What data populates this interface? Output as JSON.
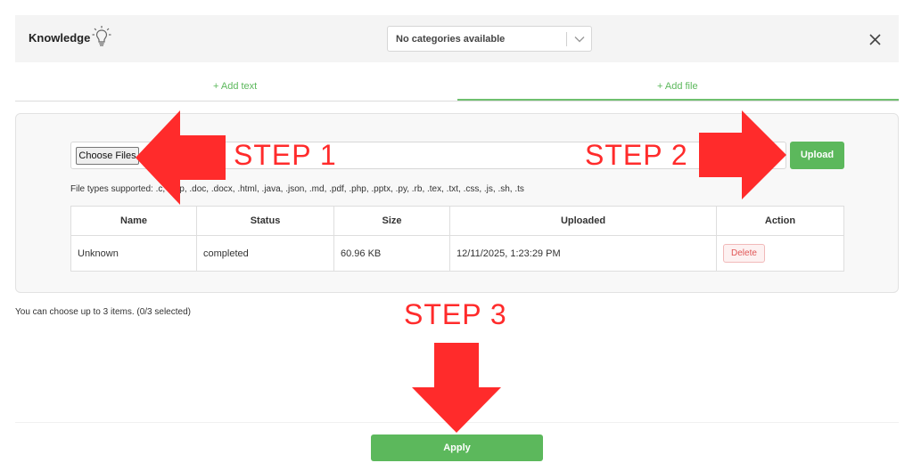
{
  "header": {
    "title": "Knowledge",
    "category_select": "No categories available"
  },
  "tabs": [
    {
      "label": "+ Add text"
    },
    {
      "label": "+ Add file"
    }
  ],
  "upload": {
    "choose_label": "Choose Files",
    "upload_label": "Upload",
    "file_types": "File types supported: .c, .cpp, .doc, .docx, .html, .java, .json, .md, .pdf, .php, .pptx, .py, .rb, .tex, .txt, .css, .js, .sh, .ts"
  },
  "table": {
    "columns": [
      "Name",
      "Status",
      "Size",
      "Uploaded",
      "Action"
    ],
    "rows": [
      {
        "name": "Unknown",
        "status": "completed",
        "size": "60.96 KB",
        "uploaded": "12/11/2025, 1:23:29 PM",
        "action": "Delete"
      }
    ]
  },
  "selection_note": "You can choose up to 3 items. (0/3 selected)",
  "apply_label": "Apply",
  "annotations": {
    "step1": "STEP 1",
    "step2": "STEP 2",
    "step3": "STEP 3",
    "color": "#ff2b2b"
  },
  "colors": {
    "accent": "#5cb85c",
    "danger": "#e05555"
  }
}
